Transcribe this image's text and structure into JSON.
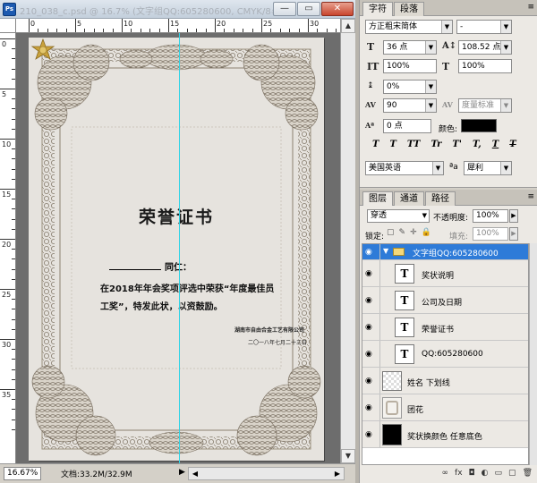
{
  "document": {
    "title": "210_038_c.psd @ 16.7% (文字组QQ:605280600, CMYK/8#)",
    "window_buttons": {
      "minimize": "—",
      "restore": "▭",
      "close": "✕"
    },
    "ruler_h_labels": [
      "0",
      "5",
      "10",
      "15",
      "20",
      "25",
      "30"
    ],
    "ruler_v_labels": [
      "0",
      "5",
      "10",
      "15",
      "20",
      "25",
      "30",
      "35"
    ],
    "status": {
      "zoom": "16.67%",
      "doc_info": "文档:33.2M/32.9M",
      "arrow": "▶"
    }
  },
  "certificate": {
    "title": "荣誉证书",
    "name_suffix": "同仁：",
    "body": "在2018年年会奖项评选中荣获“年度最佳员工奖”，特发此状，以资鼓励。",
    "company": "湖南市自由合金工艺有限公司",
    "date": "二〇一八年七月二十三日"
  },
  "character_panel": {
    "tabs": [
      "字符",
      "段落"
    ],
    "menu_icon": "≡",
    "font_family": "方正粗宋简体",
    "font_style": "-",
    "size_label": "T",
    "font_size": "36 点",
    "leading": "108.52 点",
    "vscale": "100%",
    "hscale": "100%",
    "baseline": "0%",
    "tracking": "90",
    "kerning": "度量标准",
    "baseline_shift": "0 点",
    "color_label": "颜色:",
    "color_hex": "#000000",
    "style_buttons": [
      "T",
      "T",
      "TT",
      "Tr",
      "T'",
      "T,",
      "T",
      "T"
    ],
    "language": "美国英语",
    "aa_label": "ªa",
    "antialias": "犀利"
  },
  "layers_panel": {
    "tabs": [
      "图层",
      "通道",
      "路径"
    ],
    "menu_icon": "≡",
    "blend_mode": "穿透",
    "opacity_label": "不透明度:",
    "opacity": "100%",
    "lock_label": "锁定:",
    "lock_icons": [
      "▢",
      "✎",
      "✛",
      "🔒"
    ],
    "fill_label": "填充:",
    "fill": "100%",
    "layers": [
      {
        "name": "文字组QQ:605280600",
        "type": "group",
        "selected": true
      },
      {
        "name": "奖状说明",
        "type": "text"
      },
      {
        "name": "公司及日期",
        "type": "text"
      },
      {
        "name": "荣誉证书",
        "type": "text"
      },
      {
        "name": "QQ:605280600",
        "type": "text"
      },
      {
        "name": "姓名 下划线",
        "type": "raster"
      },
      {
        "name": "团花",
        "type": "raster"
      },
      {
        "name": "奖状换颜色 任意底色",
        "type": "fill"
      }
    ],
    "footer_icons": [
      "∞",
      "fx",
      "◘",
      "◐",
      "▭",
      "▢",
      "🗑"
    ]
  }
}
